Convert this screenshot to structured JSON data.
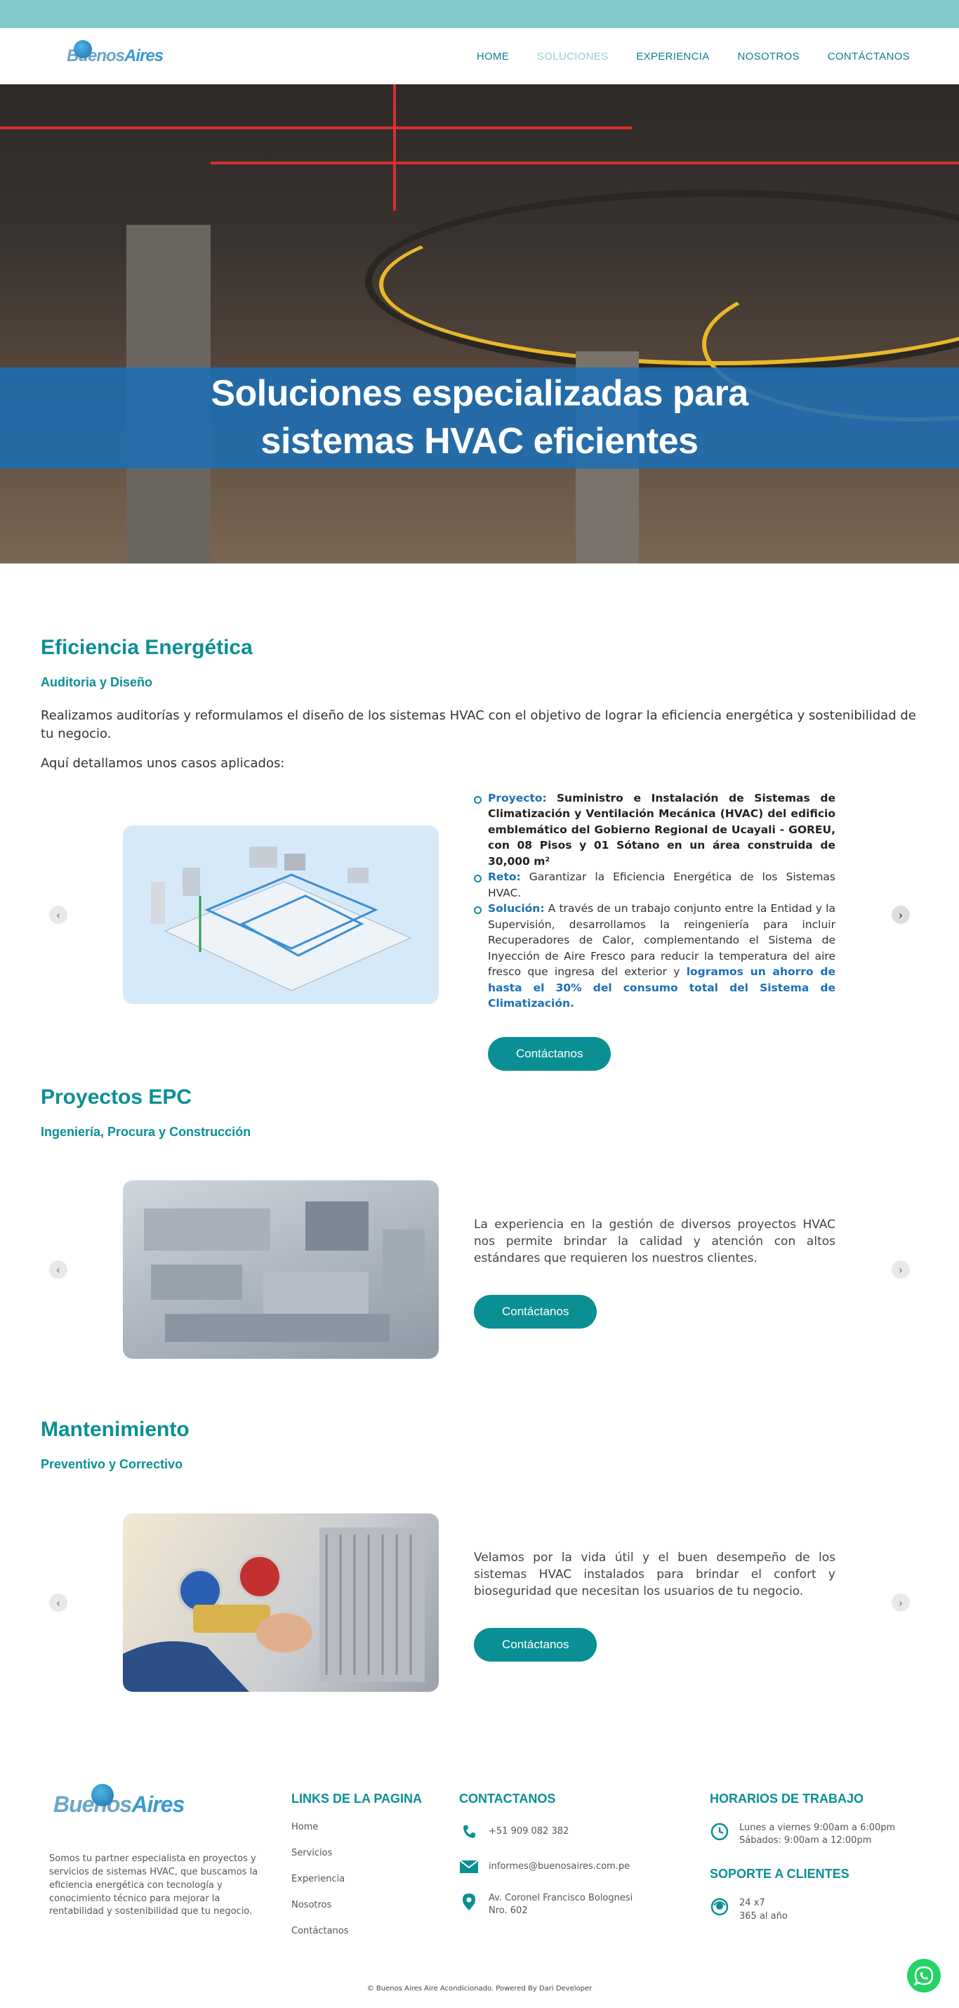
{
  "header": {
    "logo_text_a": "Buenos",
    "logo_text_b": "Aires",
    "nav": [
      "HOME",
      "SOLUCIONES",
      "EXPERIENCIA",
      "NOSOTROS",
      "CONTÁCTANOS"
    ]
  },
  "hero": {
    "title_line1": "Soluciones especializadas para",
    "title_line2": "sistemas HVAC eficientes"
  },
  "section1": {
    "title": "Eficiencia Energética",
    "subtitle": "Auditoria y Diseño",
    "text1": "Realizamos auditorías y reformulamos el diseño de los sistemas HVAC con el objetivo de lograr la eficiencia energética y sostenibilidad de tu negocio.",
    "text2": "Aquí detallamos unos casos aplicados:",
    "proyecto_label": "Proyecto:",
    "proyecto_text": "Suministro e Instalación de Sistemas de Climatización y Ventilación Mecánica (HVAC) del edificio emblemático del Gobierno Regional de Ucayali - GOREU, con 08 Pisos y 01 Sótano en un área construida de 30,000 m²",
    "reto_label": "Reto:",
    "reto_text": "Garantizar la Eficiencia Energética de los Sistemas HVAC.",
    "solucion_label": "Solución:",
    "solucion_text": "A través de un trabajo conjunto entre la Entidad y la Supervisión, desarrollamos la reingeniería para incluir Recuperadores de Calor, complementando el Sistema de Inyección de Aire Fresco para reducir la temperatura del aire fresco que ingresa del exterior y",
    "solucion_highlight": "logramos un ahorro de hasta el 30% del consumo total del Sistema de Climatización.",
    "button": "Contáctanos"
  },
  "section2": {
    "title": "Proyectos EPC",
    "subtitle": "Ingeniería, Procura y Construcción",
    "text": "La experiencia en la gestión de diversos proyectos HVAC nos permite brindar la calidad y atención con altos estándares que requieren los nuestros clientes.",
    "button": "Contáctanos"
  },
  "section3": {
    "title": "Mantenimiento",
    "subtitle": "Preventivo y Correctivo",
    "text": "Velamos por la vida útil y el buen desempeño de los sistemas HVAC instalados para brindar el confort y bioseguridad que necesitan los usuarios de tu negocio.",
    "button": "Contáctanos"
  },
  "footer": {
    "about": "Somos tu partner especialista en proyectos y servicios de sistemas HVAC, que buscamos la eficiencia energética con tecnología y conocimiento técnico para mejorar la rentabilidad y sostenibilidad que tu negocio.",
    "links_title": "LINKS DE LA PAGINA",
    "links": [
      "Home",
      "Servicios",
      "Experiencia",
      "Nosotros",
      "Contáctanos"
    ],
    "contact_title": "CONTACTANOS",
    "phone": "+51 909 082 382",
    "email": "informes@buenosaires.com.pe",
    "address": "Av. Coronel Francisco Bolognesi Nro. 602",
    "hours_title": "HORARIOS DE TRABAJO",
    "hours_1": "Lunes a viernes 9:00am a 6:00pm",
    "hours_2": "Sábados: 9:00am a 12:00pm",
    "support_title": "SOPORTE A CLIENTES",
    "support_1": "24 x7",
    "support_2": "365 al año",
    "copyright": "© Buenos Aires Aire Acondicionado. Powered By Dari Developer"
  }
}
